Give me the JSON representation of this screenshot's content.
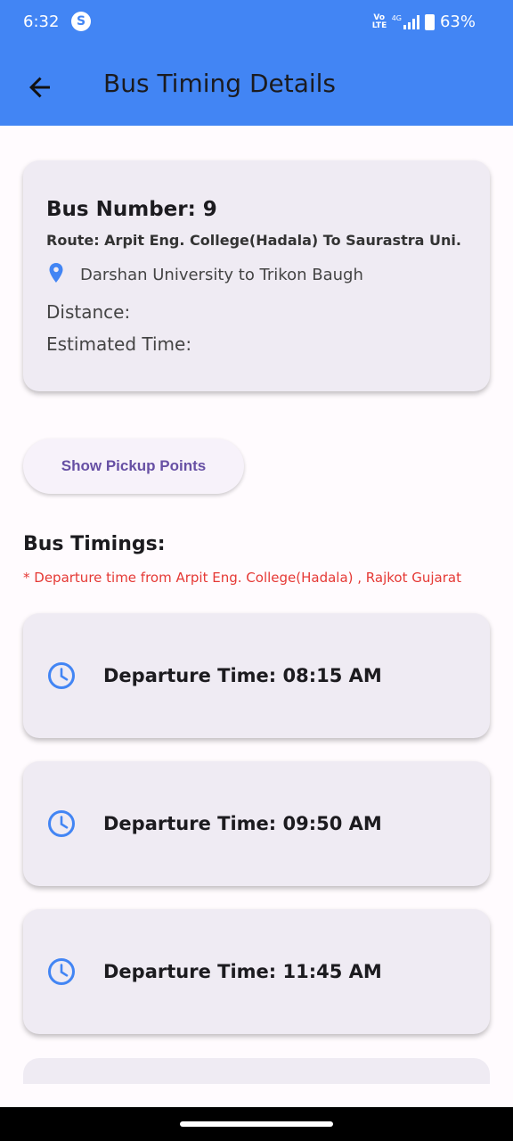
{
  "status_bar": {
    "time": "6:32",
    "app_icon": "S",
    "network_top": "Vo",
    "network_bottom": "LTE",
    "network_type": "4G",
    "battery": "63%"
  },
  "app_bar": {
    "title": "Bus Timing Details",
    "back_icon": "arrow-left-icon"
  },
  "bus_info": {
    "bus_number": "Bus Number: 9",
    "route": "Route: Arpit Eng. College(Hadala) To Saurastra Uni.",
    "location_icon": "location-pin-icon",
    "location": "Darshan University to Trikon Baugh",
    "distance": "Distance:",
    "estimated_time": "Estimated Time:"
  },
  "pickup_button": "Show Pickup Points",
  "timings": {
    "title": "Bus Timings:",
    "note": "* Departure time from Arpit Eng. College(Hadala) , Rajkot Gujarat",
    "items": [
      {
        "label": "Departure Time: 08:15 AM"
      },
      {
        "label": "Departure Time: 09:50 AM"
      },
      {
        "label": "Departure Time: 11:45 AM"
      }
    ]
  },
  "colors": {
    "app_bar": "#4285f4",
    "card": "#efebf3",
    "accent": "#6750a4",
    "note": "#e53935",
    "icon": "#4285f4"
  }
}
